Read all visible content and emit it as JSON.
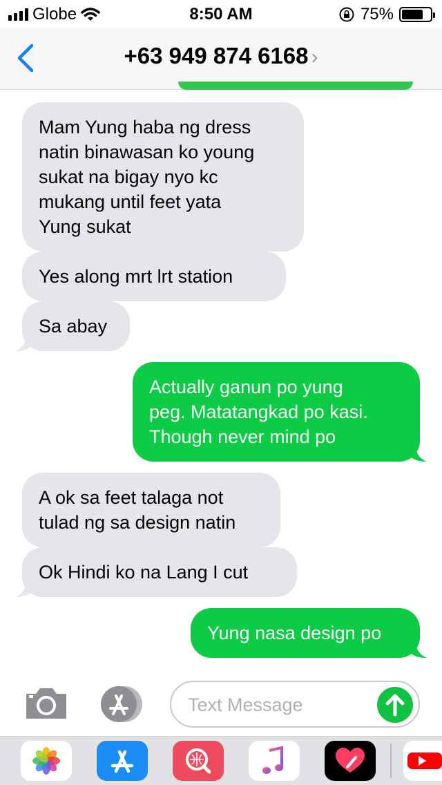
{
  "status_bar": {
    "carrier": "Globe",
    "time": "8:50 AM",
    "battery_percent": "75%",
    "battery_level": 0.75
  },
  "header": {
    "contact": "+63 949 874 6168",
    "chevron": "›"
  },
  "messages": [
    {
      "direction": "incoming",
      "lines": [
        "Mam Yung haba ng dress",
        "natin binawasan ko young",
        "sukat na bigay nyo kc",
        "mukang until feet yata",
        "Yung sukat"
      ]
    },
    {
      "direction": "incoming",
      "lines": [
        "Yes along mrt lrt station"
      ]
    },
    {
      "direction": "incoming",
      "lines": [
        "Sa abay"
      ]
    },
    {
      "direction": "outgoing",
      "lines": [
        "Actually ganun po yung",
        "peg. Matatangkad po kasi.",
        "Though never mind po"
      ]
    },
    {
      "direction": "incoming",
      "lines": [
        "A ok sa feet talaga not",
        "tulad ng sa design natin"
      ]
    },
    {
      "direction": "incoming",
      "lines": [
        "Ok Hindi ko na Lang I cut"
      ]
    },
    {
      "direction": "outgoing",
      "lines": [
        "Yung nasa design po"
      ]
    }
  ],
  "compose": {
    "placeholder": "Text Message",
    "value": ""
  },
  "icons": {
    "back": "chevron-left-icon",
    "camera": "camera-icon",
    "apps": "app-store-icon",
    "send": "arrow-up-icon",
    "drawer": [
      "photos-icon",
      "app-store-icon",
      "search-images-icon",
      "music-icon",
      "digital-touch-icon",
      "youtube-icon"
    ]
  },
  "colors": {
    "accent": "#147efb",
    "outgoing_bubble": "#0ccb44",
    "incoming_bubble": "#e5e5ea",
    "send_button": "#10c241"
  }
}
